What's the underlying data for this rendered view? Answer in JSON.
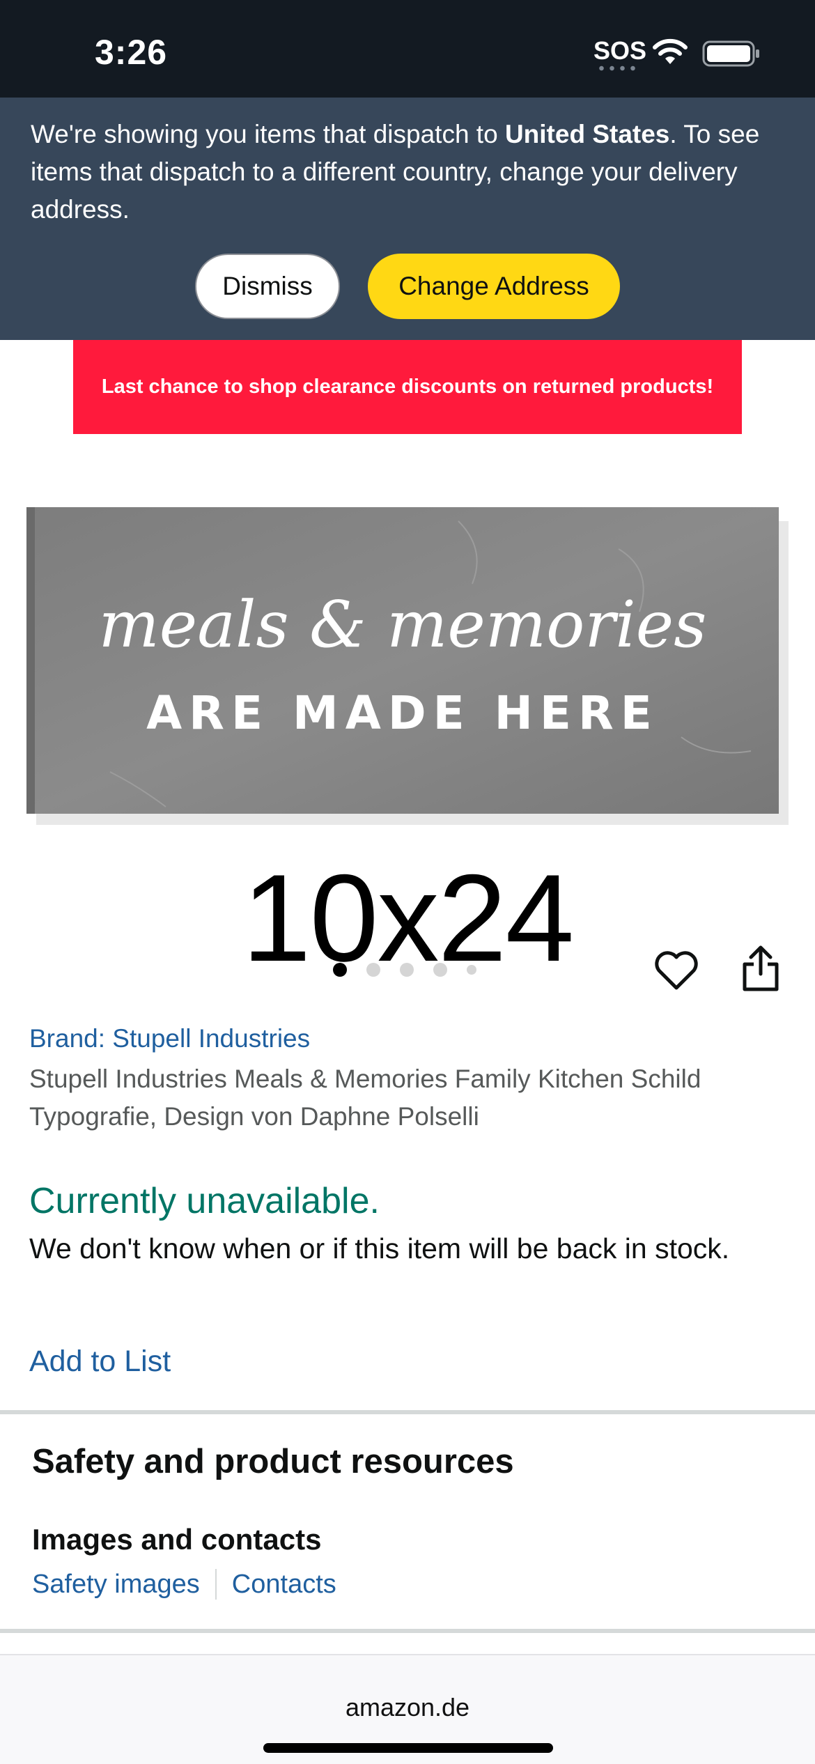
{
  "status_bar": {
    "time": "3:26",
    "sos": "SOS",
    "icons": [
      "wifi-icon",
      "battery-icon"
    ]
  },
  "dispatch_banner": {
    "text_before": "We're showing you items that dispatch to ",
    "country": "United States",
    "text_after": ". To see items that dispatch to a different country, change your delivery address.",
    "dismiss_label": "Dismiss",
    "change_address_label": "Change Address"
  },
  "promo": {
    "text": "Last chance to shop clearance discounts on returned products!"
  },
  "product_image": {
    "script_text": "meals & memories",
    "caption": "ARE MADE HERE",
    "size_label": "10x24",
    "carousel": {
      "count": 5,
      "active_index": 0
    },
    "icons": [
      "heart-icon",
      "share-icon"
    ]
  },
  "product": {
    "brand": "Brand: Stupell Industries",
    "title": "Stupell Industries Meals & Memories Family Kitchen Schild Typografie, Design von Daphne Polselli",
    "availability": "Currently unavailable.",
    "availability_note": "We don't know when or if this item will be back in stock.",
    "add_to_list": "Add to List"
  },
  "safety": {
    "heading": "Safety and product resources",
    "subheading": "Images and contacts",
    "links": [
      "Safety images",
      "Contacts"
    ]
  },
  "browser": {
    "url": "amazon.de"
  },
  "colors": {
    "banner_bg": "#37475a",
    "status_bg": "#131a22",
    "promo_red": "#ff1a3c",
    "button_yellow": "#ffd814",
    "link_blue": "#1f5f9f",
    "availability_green": "#007565"
  }
}
